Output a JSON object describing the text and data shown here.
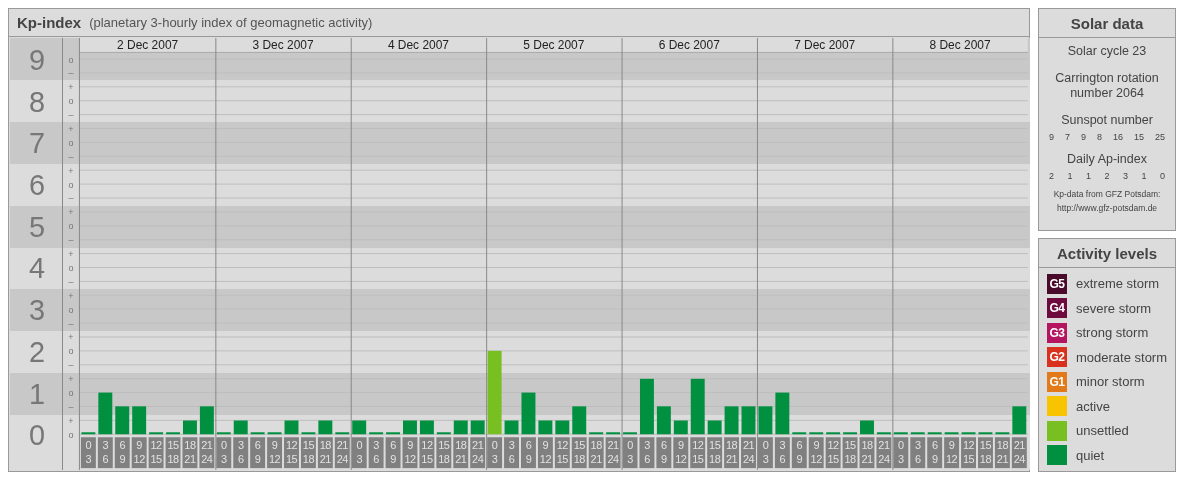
{
  "header": {
    "title": "Kp-index",
    "subtitle": "(planetary 3-hourly index of geomagnetic activity)"
  },
  "kp_chart": {
    "days": [
      "2 Dec 2007",
      "3 Dec 2007",
      "4 Dec 2007",
      "5 Dec 2007",
      "6 Dec 2007",
      "7 Dec 2007",
      "8 Dec 2007"
    ],
    "sub_ticks": [
      "o",
      "–",
      "+",
      "o",
      "–",
      "+",
      "o",
      "–",
      "+",
      "o",
      "–",
      "+",
      "o",
      "–",
      "+",
      "o",
      "–",
      "+",
      "o",
      "–",
      "+",
      "o",
      "–",
      "+",
      "o",
      "–",
      "+",
      "o"
    ],
    "chart_data": {
      "type": "bar",
      "ylim": [
        0,
        9.17
      ],
      "grid": true,
      "yticks": [
        {
          "value": 0,
          "label": "0"
        },
        {
          "value": 1,
          "label": "1"
        },
        {
          "value": 2,
          "label": "2"
        },
        {
          "value": 3,
          "label": "3"
        },
        {
          "value": 4,
          "label": "4"
        },
        {
          "value": 5,
          "label": "5"
        },
        {
          "value": 6,
          "label": "6"
        },
        {
          "value": 7,
          "label": "7"
        },
        {
          "value": 8,
          "label": "8"
        },
        {
          "value": 9,
          "label": "9"
        }
      ],
      "categories": [
        "0 3",
        "3 6",
        "6 9",
        "9 12",
        "12 15",
        "15 18",
        "18 21",
        "21 24",
        "0 3",
        "3 6",
        "6 9",
        "9 12",
        "12 15",
        "15 18",
        "18 21",
        "21 24",
        "0 3",
        "3 6",
        "6 9",
        "9 12",
        "12 15",
        "15 18",
        "18 21",
        "21 24",
        "0 3",
        "3 6",
        "6 9",
        "9 12",
        "12 15",
        "15 18",
        "18 21",
        "21 24",
        "0 3",
        "3 6",
        "6 9",
        "9 12",
        "12 15",
        "15 18",
        "18 21",
        "21 24",
        "0 3",
        "3 6",
        "6 9",
        "9 12",
        "12 15",
        "15 18",
        "18 21",
        "21 24",
        "0 3",
        "3 6",
        "6 9",
        "9 12",
        "12 15",
        "15 18",
        "18 21",
        "21 24"
      ],
      "series": [
        {
          "values": [
            0,
            1,
            0.67,
            0.67,
            0,
            0,
            0.33,
            0.67,
            0,
            0.33,
            0,
            0,
            0.33,
            0,
            0.33,
            0,
            0.33,
            0,
            0,
            0.33,
            0.33,
            0,
            0.33,
            0.33,
            2,
            0.33,
            1,
            0.33,
            0.33,
            0.67,
            0,
            0,
            0,
            1.33,
            0.67,
            0.33,
            1.33,
            0.33,
            0.67,
            0.67,
            0.67,
            1,
            0,
            0,
            0,
            0,
            0.33,
            0,
            0,
            0,
            0,
            0,
            0,
            0,
            0,
            0.67
          ]
        }
      ]
    }
  },
  "solar_data": {
    "heading": "Solar data",
    "cycle": "Solar cycle 23",
    "rotation": "Carrington rotation number 2064",
    "sunspot_label": "Sunspot number",
    "sunspot_numbers": [
      "9",
      "7",
      "9",
      "8",
      "16",
      "15",
      "25"
    ],
    "ap_label": "Daily Ap-index",
    "ap_values": [
      "2",
      "1",
      "1",
      "2",
      "3",
      "1",
      "0"
    ],
    "credit": "Kp-data from GFZ Potsdam:",
    "credit_url": "http://www.gfz-potsdam.de"
  },
  "activity_levels": {
    "heading": "Activity levels",
    "items": [
      {
        "badge": "G5",
        "label": "extreme storm",
        "color": "#4a0a2a"
      },
      {
        "badge": "G4",
        "label": "severe storm",
        "color": "#6e0a3e"
      },
      {
        "badge": "G3",
        "label": "strong storm",
        "color": "#b41460"
      },
      {
        "badge": "G2",
        "label": "moderate storm",
        "color": "#d8321e"
      },
      {
        "badge": "G1",
        "label": "minor storm",
        "color": "#e27a1a"
      },
      {
        "label": "active",
        "color": "#f8c400"
      },
      {
        "label": "unsettled",
        "color": "#78c022"
      },
      {
        "label": "quiet",
        "color": "#009040"
      }
    ]
  }
}
